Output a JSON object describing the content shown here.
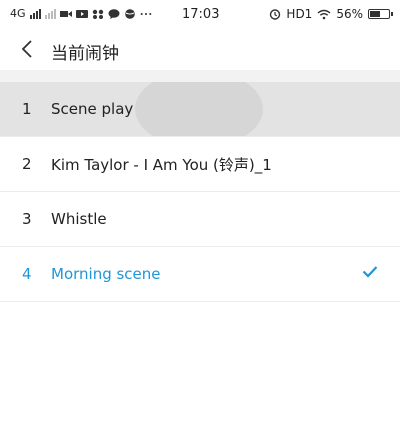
{
  "status_bar": {
    "network": "4G",
    "time": "17:03",
    "hd": "HD1",
    "battery": "56%",
    "battery_level": 0.56
  },
  "header": {
    "title": "当前闹钟"
  },
  "alarm_list": [
    {
      "index": "1",
      "label": "Scene play",
      "selected": false
    },
    {
      "index": "2",
      "label": "Kim Taylor - I Am You (铃声)_1",
      "selected": false
    },
    {
      "index": "3",
      "label": "Whistle",
      "selected": false
    },
    {
      "index": "4",
      "label": "Morning scene",
      "selected": true
    }
  ],
  "colors": {
    "accent": "#2196d6",
    "pressed_row": "#e3e3e3"
  }
}
